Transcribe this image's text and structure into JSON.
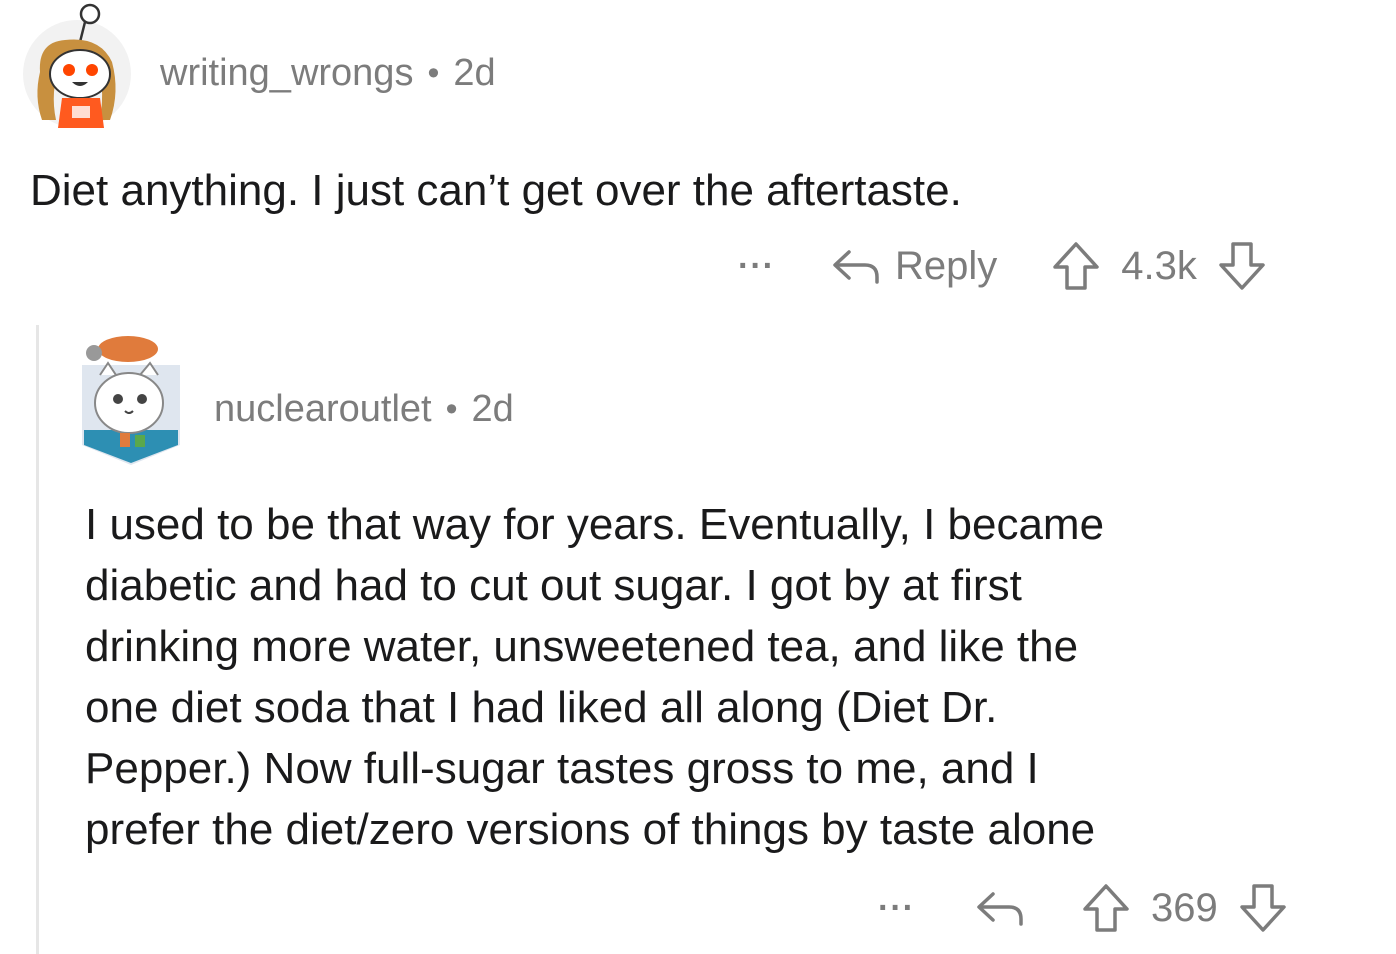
{
  "comments": [
    {
      "username": "writing_wrongs",
      "separator": "•",
      "age": "2d",
      "body": "Diet anything. I just can’t get over the aftertaste.",
      "actions": {
        "more_label": "···",
        "reply_label": "Reply",
        "vote_count": "4.3k"
      },
      "icons": [
        "avatar-snoo",
        "more-icon",
        "reply-icon",
        "upvote-icon",
        "downvote-icon"
      ]
    },
    {
      "username": "nuclearoutlet",
      "separator": "•",
      "age": "2d",
      "body_lines": [
        "I used to be that way for years. Eventually, I became",
        "diabetic and had to cut out sugar. I got by at first",
        "drinking more water, unsweetened tea, and like the",
        "one diet soda that I had liked all along (Diet Dr.",
        "Pepper.) Now full-sugar tastes gross to me, and I",
        "prefer the diet/zero versions of things by taste alone"
      ],
      "actions": {
        "more_label": "···",
        "vote_count": "369"
      },
      "icons": [
        "avatar-cat",
        "more-icon",
        "reply-icon",
        "upvote-icon",
        "downvote-icon"
      ]
    }
  ],
  "colors": {
    "meta_text": "#7c7c7c",
    "body_text": "#1a1a1b",
    "thread_line": "#e6e6e6",
    "avatar_orange": "#ff4500"
  }
}
